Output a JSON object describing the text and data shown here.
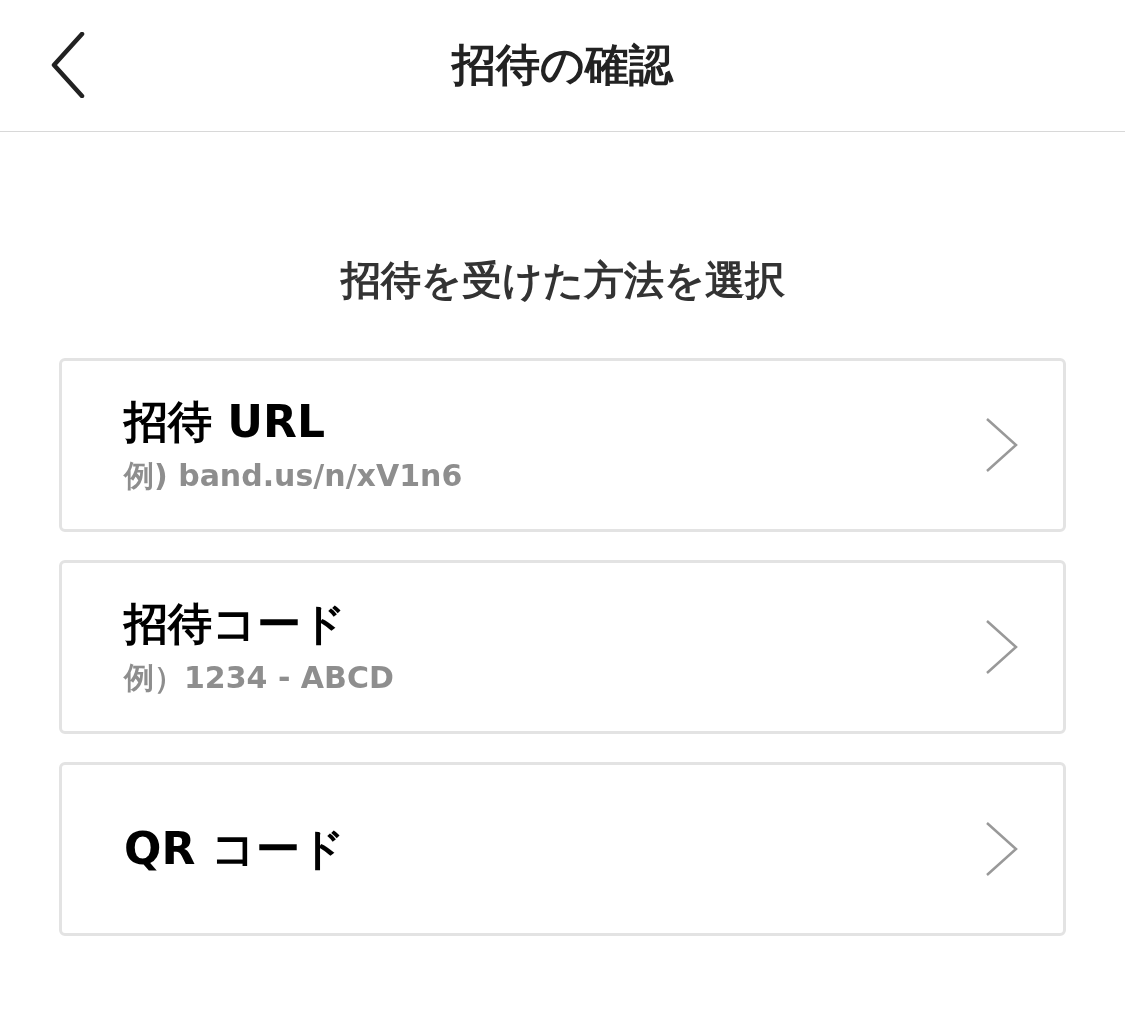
{
  "header": {
    "title": "招待の確認"
  },
  "prompt": "招待を受けた方法を選択",
  "options": [
    {
      "title": "招待 URL",
      "example": "例) band.us/n/xV1n6"
    },
    {
      "title": "招待コード",
      "example": "例）1234 - ABCD"
    },
    {
      "title": "QR コード"
    }
  ]
}
